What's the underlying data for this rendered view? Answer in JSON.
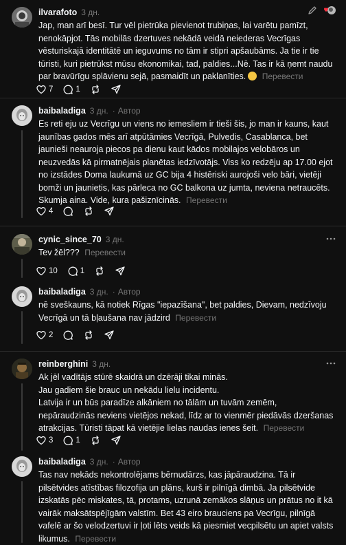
{
  "posts": [
    {
      "username": "ilvarafoto",
      "time": "3 дн.",
      "text": "Jap, man arī besī. Tur vēl pietrūka pievienot trubiņas, lai varētu pamīzt, nenokāpjot. Tās mobilās dzertuves nekādā veidā neiederas Vecrīgas vēsturiskajā identitātē un ieguvums no tām ir stipri apšaubāms. Ja tie ir tie tūristi, kuri pietrūkst mūsu ekonomikai, tad, paldies...Nē. Tas ir kā ņemt naudu par bravūrīgu splāvienu sejā, pasmaidīt un paklanīties.",
      "translate": "Перевести",
      "likes": "7",
      "replies": "1"
    },
    {
      "username": "baibaladiga",
      "time": "3 дн.",
      "author": "Автор",
      "text": "Es reti eju uz Vecrīgu un viens no iemesliem ir tieši šis, jo man ir kauns, kaut jaunības gados mēs arī atpūtāmies Vecrīgā, Pulvedis, Casablanca, bet jaunieši neauroja piecos pa dienu kaut kādos mobilajos velobāros un neuzvedās kā pirmatnējais planētas iedzīvotājs. Viss ko redzēju ap 17.00 ejot no izstādes Doma laukumā uz GC bija 4 histēriski aurojoši velo bāri, vietēji bomži un jaunietis, kas pārleca no GC balkona uz jumta, neviena netraucēts. Skumja aina. Vide, kura pašiznīcinās.",
      "translate": "Перевести",
      "likes": "4",
      "replies": ""
    },
    {
      "username": "cynic_since_70",
      "time": "3 дн.",
      "text": "Tev žēl???",
      "translate": "Перевести",
      "likes": "10",
      "replies": "1"
    },
    {
      "username": "baibaladiga",
      "time": "3 дн.",
      "author": "Автор",
      "text": "nē sveškauns, kā notiek Rīgas \"iepazīšana\", bet paldies, Dievam, nedzīvoju Vecrīgā un tā bļaušana nav jādzird",
      "translate": "Перевести",
      "likes": "2",
      "replies": ""
    },
    {
      "username": "reinberghini",
      "time": "3 дн.",
      "lines": [
        "Ak jēl vadītājs stūrē skaidrā un dzērāji tikai minās.",
        "Jau gadiem šie brauc un nekādu lielu incidentu.",
        "Latvija ir un būs paradīze alkāniem no tālām un tuvām zemēm, nepāraudzinās neviens vietējos nekad, līdz ar to vienmēr piedāvās dzeršanas atrakcijas. Tūristi tāpat kā vietējie lielas naudas ienes šeit."
      ],
      "translate": "Перевести",
      "likes": "3",
      "replies": "1"
    },
    {
      "username": "baibaladiga",
      "time": "3 дн.",
      "author": "Автор",
      "text": "Tas nav nekāds nekontrolējams bērnudārzs, kas jāpāraudzina. Tā ir pilsētvides atīstības filozofija un plāns, kurš ir pilnīgā dimbā. Ja pilsētvide izskatās pēc miskates, tā, protams, uzrunā zemākos slāņus un prātus no it kā vairāk maksātspējīgām valstīm. Bet 43 eiro brauciens pa Vecrīgu, pilnīgā vafelē ar šo velodzertuvi ir ļoti lēts veids kā piesmiet vecpilsētu un apiet valsts likumus.",
      "translate": "Перевести"
    }
  ],
  "colors": {
    "background": "#101010",
    "text": "#f3f5f7",
    "secondary": "#777777",
    "divider": "#2b2b2b",
    "thread_line": "#3a3a3a",
    "heart_red": "#ff3040"
  },
  "icons": [
    "heart-icon",
    "comment-icon",
    "repost-icon",
    "share-icon",
    "more-icon",
    "pencil-icon"
  ]
}
